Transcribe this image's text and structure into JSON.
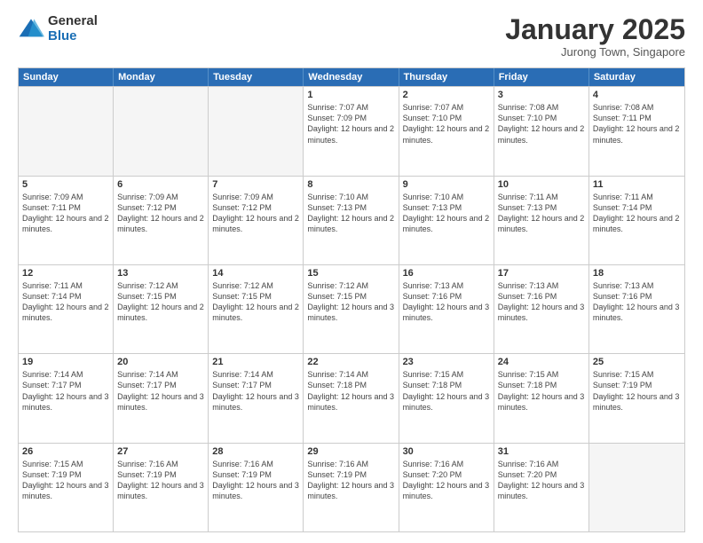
{
  "header": {
    "logo_general": "General",
    "logo_blue": "Blue",
    "month_title": "January 2025",
    "location": "Jurong Town, Singapore"
  },
  "weekdays": [
    "Sunday",
    "Monday",
    "Tuesday",
    "Wednesday",
    "Thursday",
    "Friday",
    "Saturday"
  ],
  "rows": [
    [
      {
        "day": "",
        "empty": true
      },
      {
        "day": "",
        "empty": true
      },
      {
        "day": "",
        "empty": true
      },
      {
        "day": "1",
        "sunrise": "7:07 AM",
        "sunset": "7:09 PM",
        "daylight": "12 hours and 2 minutes."
      },
      {
        "day": "2",
        "sunrise": "7:07 AM",
        "sunset": "7:10 PM",
        "daylight": "12 hours and 2 minutes."
      },
      {
        "day": "3",
        "sunrise": "7:08 AM",
        "sunset": "7:10 PM",
        "daylight": "12 hours and 2 minutes."
      },
      {
        "day": "4",
        "sunrise": "7:08 AM",
        "sunset": "7:11 PM",
        "daylight": "12 hours and 2 minutes."
      }
    ],
    [
      {
        "day": "5",
        "sunrise": "7:09 AM",
        "sunset": "7:11 PM",
        "daylight": "12 hours and 2 minutes."
      },
      {
        "day": "6",
        "sunrise": "7:09 AM",
        "sunset": "7:12 PM",
        "daylight": "12 hours and 2 minutes."
      },
      {
        "day": "7",
        "sunrise": "7:09 AM",
        "sunset": "7:12 PM",
        "daylight": "12 hours and 2 minutes."
      },
      {
        "day": "8",
        "sunrise": "7:10 AM",
        "sunset": "7:13 PM",
        "daylight": "12 hours and 2 minutes."
      },
      {
        "day": "9",
        "sunrise": "7:10 AM",
        "sunset": "7:13 PM",
        "daylight": "12 hours and 2 minutes."
      },
      {
        "day": "10",
        "sunrise": "7:11 AM",
        "sunset": "7:13 PM",
        "daylight": "12 hours and 2 minutes."
      },
      {
        "day": "11",
        "sunrise": "7:11 AM",
        "sunset": "7:14 PM",
        "daylight": "12 hours and 2 minutes."
      }
    ],
    [
      {
        "day": "12",
        "sunrise": "7:11 AM",
        "sunset": "7:14 PM",
        "daylight": "12 hours and 2 minutes."
      },
      {
        "day": "13",
        "sunrise": "7:12 AM",
        "sunset": "7:15 PM",
        "daylight": "12 hours and 2 minutes."
      },
      {
        "day": "14",
        "sunrise": "7:12 AM",
        "sunset": "7:15 PM",
        "daylight": "12 hours and 2 minutes."
      },
      {
        "day": "15",
        "sunrise": "7:12 AM",
        "sunset": "7:15 PM",
        "daylight": "12 hours and 3 minutes."
      },
      {
        "day": "16",
        "sunrise": "7:13 AM",
        "sunset": "7:16 PM",
        "daylight": "12 hours and 3 minutes."
      },
      {
        "day": "17",
        "sunrise": "7:13 AM",
        "sunset": "7:16 PM",
        "daylight": "12 hours and 3 minutes."
      },
      {
        "day": "18",
        "sunrise": "7:13 AM",
        "sunset": "7:16 PM",
        "daylight": "12 hours and 3 minutes."
      }
    ],
    [
      {
        "day": "19",
        "sunrise": "7:14 AM",
        "sunset": "7:17 PM",
        "daylight": "12 hours and 3 minutes."
      },
      {
        "day": "20",
        "sunrise": "7:14 AM",
        "sunset": "7:17 PM",
        "daylight": "12 hours and 3 minutes."
      },
      {
        "day": "21",
        "sunrise": "7:14 AM",
        "sunset": "7:17 PM",
        "daylight": "12 hours and 3 minutes."
      },
      {
        "day": "22",
        "sunrise": "7:14 AM",
        "sunset": "7:18 PM",
        "daylight": "12 hours and 3 minutes."
      },
      {
        "day": "23",
        "sunrise": "7:15 AM",
        "sunset": "7:18 PM",
        "daylight": "12 hours and 3 minutes."
      },
      {
        "day": "24",
        "sunrise": "7:15 AM",
        "sunset": "7:18 PM",
        "daylight": "12 hours and 3 minutes."
      },
      {
        "day": "25",
        "sunrise": "7:15 AM",
        "sunset": "7:19 PM",
        "daylight": "12 hours and 3 minutes."
      }
    ],
    [
      {
        "day": "26",
        "sunrise": "7:15 AM",
        "sunset": "7:19 PM",
        "daylight": "12 hours and 3 minutes."
      },
      {
        "day": "27",
        "sunrise": "7:16 AM",
        "sunset": "7:19 PM",
        "daylight": "12 hours and 3 minutes."
      },
      {
        "day": "28",
        "sunrise": "7:16 AM",
        "sunset": "7:19 PM",
        "daylight": "12 hours and 3 minutes."
      },
      {
        "day": "29",
        "sunrise": "7:16 AM",
        "sunset": "7:19 PM",
        "daylight": "12 hours and 3 minutes."
      },
      {
        "day": "30",
        "sunrise": "7:16 AM",
        "sunset": "7:20 PM",
        "daylight": "12 hours and 3 minutes."
      },
      {
        "day": "31",
        "sunrise": "7:16 AM",
        "sunset": "7:20 PM",
        "daylight": "12 hours and 3 minutes."
      },
      {
        "day": "",
        "empty": true
      }
    ]
  ],
  "labels": {
    "sunrise": "Sunrise:",
    "sunset": "Sunset:",
    "daylight": "Daylight:"
  }
}
